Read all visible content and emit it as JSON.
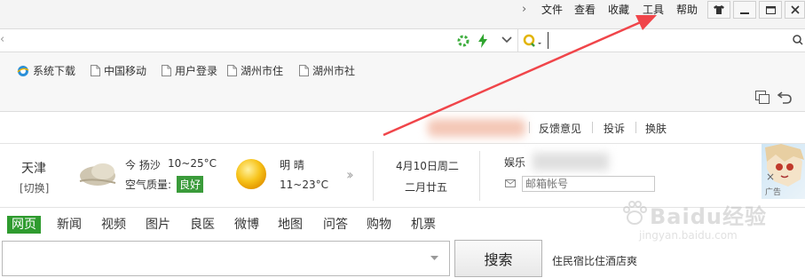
{
  "menubar": {
    "items": [
      "文件",
      "查看",
      "收藏",
      "工具",
      "帮助"
    ]
  },
  "addressbar": {
    "url_value": "",
    "search_value": ""
  },
  "bookmarks": [
    {
      "label": "系统下载",
      "icon": "ie-globe-icon"
    },
    {
      "label": "中国移动",
      "icon": "page-icon"
    },
    {
      "label": "用户登录",
      "icon": "page-icon"
    },
    {
      "label": "湖州市住",
      "icon": "page-icon"
    },
    {
      "label": "湖州市社",
      "icon": "page-icon"
    }
  ],
  "toplinks": {
    "feedback": "反馈意见",
    "complaint": "投诉",
    "skin": "换肤"
  },
  "weather": {
    "city": "天津",
    "switch": "[切换]",
    "today_label": "今 扬沙",
    "today_temp": "10~25°C",
    "air_label": "空气质量:",
    "air_value": "良好",
    "tomorrow_label": "明  晴",
    "tomorrow_temp": "11~23°C"
  },
  "date": {
    "solar": "4月10日周二",
    "lunar": "二月廿五"
  },
  "mail": {
    "label": "娱乐",
    "placeholder": "邮箱帐号"
  },
  "ad": {
    "close": "×",
    "tag": "广告"
  },
  "tabs": [
    "网页",
    "新闻",
    "视频",
    "图片",
    "良医",
    "微博",
    "地图",
    "问答",
    "购物",
    "机票"
  ],
  "search": {
    "button": "搜索",
    "hint": "住民宿比住酒店爽"
  },
  "watermark": {
    "brand": "Baidu经验",
    "url": "jingyan.baidu.com"
  },
  "colors": {
    "arrow": "#f0454a",
    "tab_active": "#2f9b2f",
    "air_badge": "#3a9b3a"
  }
}
